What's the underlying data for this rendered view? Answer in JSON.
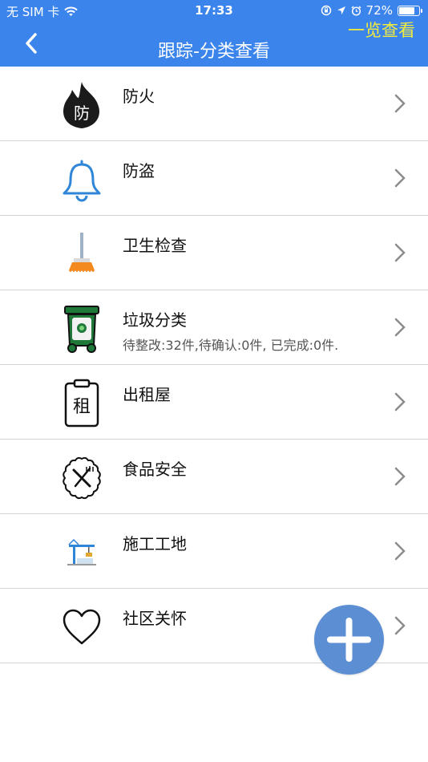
{
  "status_bar": {
    "carrier": "无 SIM 卡",
    "time": "17:33",
    "battery_percent": "72%",
    "battery_level": 0.72
  },
  "nav": {
    "title": "跟踪-分类查看",
    "right_action": "一览查看"
  },
  "categories": [
    {
      "label": "防火",
      "icon": "fire-icon",
      "icon_text": "防"
    },
    {
      "label": "防盗",
      "icon": "bell-icon"
    },
    {
      "label": "卫生检查",
      "icon": "broom-icon"
    },
    {
      "label": "垃圾分类",
      "icon": "trash-bin-icon",
      "summary": "待整改:32件,待确认:0件, 已完成:0件."
    },
    {
      "label": "出租屋",
      "icon": "rent-clipboard-icon",
      "icon_text": "租"
    },
    {
      "label": "食品安全",
      "icon": "food-safety-icon"
    },
    {
      "label": "施工工地",
      "icon": "construction-crane-icon"
    },
    {
      "label": "社区关怀",
      "icon": "heart-icon"
    }
  ],
  "colors": {
    "header_bg": "#3b84ec",
    "right_action": "#f4ec3b",
    "fab": "#5c8ed4"
  }
}
